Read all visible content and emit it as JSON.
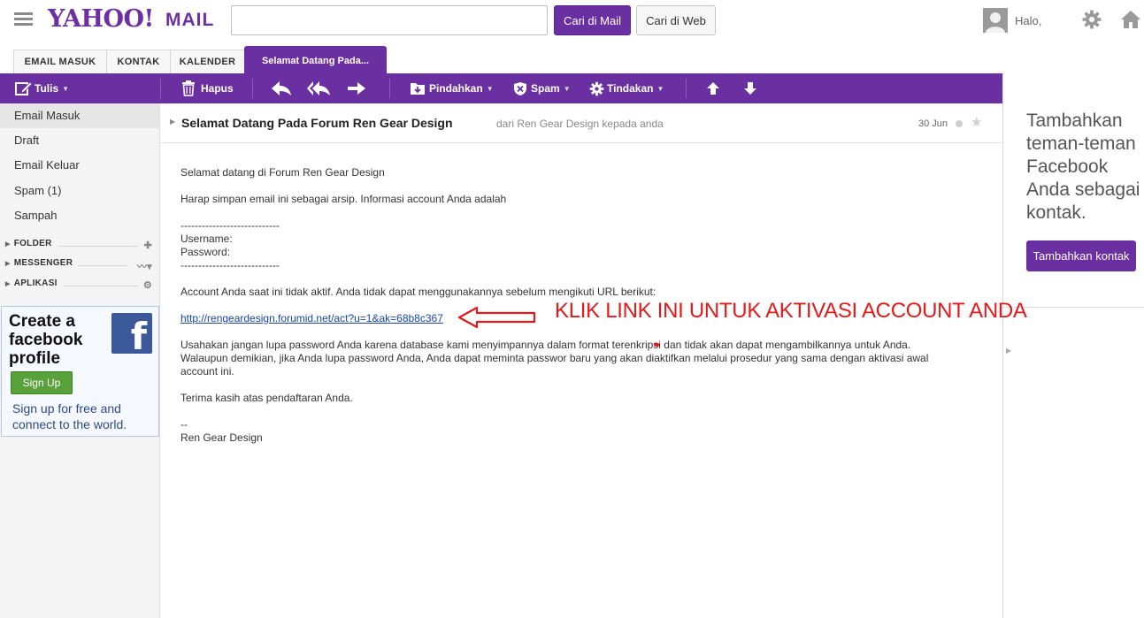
{
  "header": {
    "logo": "YAHOO!",
    "logo_sub": "MAIL",
    "search_value": "",
    "search_mail_label": "Cari di Mail",
    "search_web_label": "Cari di Web",
    "greeting": "Halo,"
  },
  "tabs": [
    {
      "label": "EMAIL MASUK"
    },
    {
      "label": "KONTAK"
    },
    {
      "label": "KALENDER"
    },
    {
      "label": "Selamat Datang Pada..."
    }
  ],
  "toolbar": {
    "compose": "Tulis",
    "delete": "Hapus",
    "move": "Pindahkan",
    "spam": "Spam",
    "actions": "Tindakan"
  },
  "sidebar": {
    "items": [
      {
        "label": "Email Masuk"
      },
      {
        "label": "Draft"
      },
      {
        "label": "Email Keluar"
      },
      {
        "label": "Spam (1)"
      },
      {
        "label": "Sampah"
      }
    ],
    "sections": [
      {
        "label": "FOLDER"
      },
      {
        "label": "MESSENGER"
      },
      {
        "label": "APLIKASI"
      }
    ]
  },
  "fb_ad": {
    "title": "Create a facebook profile",
    "signup": "Sign Up",
    "subtitle": "Sign up for free and connect to the world."
  },
  "right_panel": {
    "text": "Tambahkan teman-teman Facebook Anda sebagai kontak.",
    "button": "Tambahkan kontak"
  },
  "message": {
    "subject": "Selamat Datang Pada Forum Ren Gear Design",
    "from": "dari Ren Gear Design kepada anda",
    "date": "30 Jun",
    "body": {
      "greeting": "Selamat datang di Forum Ren Gear Design",
      "keep": "Harap simpan email ini sebagai arsip. Informasi account Anda adalah",
      "divider": "----------------------------",
      "username": "Username:",
      "password": "Password:",
      "inactive": "Account Anda saat ini tidak aktif. Anda tidak dapat menggunakannya sebelum mengikuti URL berikut:",
      "link": "http://rengeardesign.forumid.net/act?u=1&ak=68b8c367",
      "para1": "Usahakan jangan lupa password Anda karena database kami menyimpannya dalam format terenkripsi dan tidak akan dapat mengambilkannya untuk Anda.",
      "para2": "Walaupun demikian, jika Anda lupa password Anda, Anda dapat meminta passwor baru yang akan diaktifkan melalui prosedur yang sama dengan aktivasi awal",
      "para3": "account ini.",
      "thanks": "Terima kasih atas pendaftaran Anda.",
      "sig_dash": "--",
      "signature": "Ren Gear Design"
    },
    "annotation": "KLIK LINK INI UNTUK AKTIVASI ACCOUNT ANDA"
  },
  "colors": {
    "brand_purple": "#6a2fa0",
    "annotation_red": "#e41a1a",
    "link_blue": "#1a45a8",
    "facebook_blue": "#3b5998",
    "signup_green": "#59a13b"
  }
}
